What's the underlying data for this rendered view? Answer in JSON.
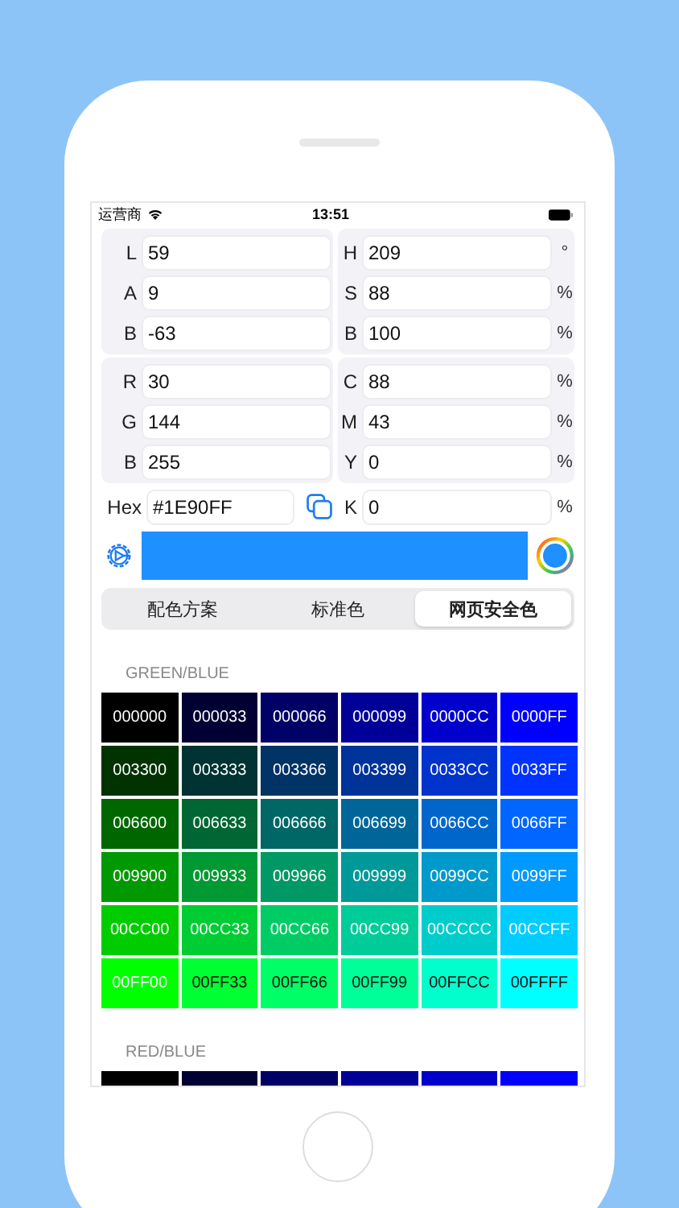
{
  "status_bar": {
    "carrier": "运营商",
    "time": "13:51"
  },
  "panels": [
    {
      "left": [
        {
          "label": "L",
          "value": "59"
        },
        {
          "label": "A",
          "value": "9"
        },
        {
          "label": "B",
          "value": "-63"
        }
      ],
      "right": [
        {
          "label": "H",
          "value": "209",
          "unit": "°"
        },
        {
          "label": "S",
          "value": "88",
          "unit": "%"
        },
        {
          "label": "B",
          "value": "100",
          "unit": "%"
        }
      ]
    },
    {
      "left": [
        {
          "label": "R",
          "value": "30"
        },
        {
          "label": "G",
          "value": "144"
        },
        {
          "label": "B",
          "value": "255"
        }
      ],
      "right": [
        {
          "label": "C",
          "value": "88",
          "unit": "%"
        },
        {
          "label": "M",
          "value": "43",
          "unit": "%"
        },
        {
          "label": "Y",
          "value": "0",
          "unit": "%"
        }
      ]
    }
  ],
  "hex": {
    "label": "Hex",
    "value": "#1E90FF"
  },
  "k": {
    "label": "K",
    "value": "0",
    "unit": "%"
  },
  "preview": {
    "color": "#1e90ff"
  },
  "tabs": [
    {
      "label": "配色方案",
      "selected": false
    },
    {
      "label": "标准色",
      "selected": false
    },
    {
      "label": "网页安全色",
      "selected": true
    }
  ],
  "sections": [
    {
      "title": "GREEN/BLUE",
      "swatches": [
        {
          "label": "000000",
          "color": "#000000"
        },
        {
          "label": "000033",
          "color": "#000033"
        },
        {
          "label": "000066",
          "color": "#000066"
        },
        {
          "label": "000099",
          "color": "#000099"
        },
        {
          "label": "0000CC",
          "color": "#0000cc"
        },
        {
          "label": "0000FF",
          "color": "#0000ff"
        },
        {
          "label": "003300",
          "color": "#003300"
        },
        {
          "label": "003333",
          "color": "#003333"
        },
        {
          "label": "003366",
          "color": "#003366"
        },
        {
          "label": "003399",
          "color": "#003399"
        },
        {
          "label": "0033CC",
          "color": "#0033cc"
        },
        {
          "label": "0033FF",
          "color": "#0033ff"
        },
        {
          "label": "006600",
          "color": "#006600"
        },
        {
          "label": "006633",
          "color": "#006633"
        },
        {
          "label": "006666",
          "color": "#006666"
        },
        {
          "label": "006699",
          "color": "#006699"
        },
        {
          "label": "0066CC",
          "color": "#0066cc"
        },
        {
          "label": "0066FF",
          "color": "#0066ff"
        },
        {
          "label": "009900",
          "color": "#009900"
        },
        {
          "label": "009933",
          "color": "#009933"
        },
        {
          "label": "009966",
          "color": "#009966"
        },
        {
          "label": "009999",
          "color": "#009999"
        },
        {
          "label": "0099CC",
          "color": "#0099cc"
        },
        {
          "label": "0099FF",
          "color": "#0099ff"
        },
        {
          "label": "00CC00",
          "color": "#00cc00"
        },
        {
          "label": "00CC33",
          "color": "#00cc33"
        },
        {
          "label": "00CC66",
          "color": "#00cc66"
        },
        {
          "label": "00CC99",
          "color": "#00cc99"
        },
        {
          "label": "00CCCC",
          "color": "#00cccc"
        },
        {
          "label": "00CCFF",
          "color": "#00ccff"
        },
        {
          "label": "00FF00",
          "color": "#00ff00"
        },
        {
          "label": "00FF33",
          "color": "#00ff33"
        },
        {
          "label": "00FF66",
          "color": "#00ff66"
        },
        {
          "label": "00FF99",
          "color": "#00ff99"
        },
        {
          "label": "00FFCC",
          "color": "#00ffcc"
        },
        {
          "label": "00FFFF",
          "color": "#00ffff"
        }
      ]
    },
    {
      "title": "RED/BLUE",
      "swatches": [
        {
          "color": "#000000"
        },
        {
          "color": "#000033"
        },
        {
          "color": "#000066"
        },
        {
          "color": "#000099"
        },
        {
          "color": "#0000cc"
        },
        {
          "color": "#0000ff"
        }
      ]
    }
  ]
}
